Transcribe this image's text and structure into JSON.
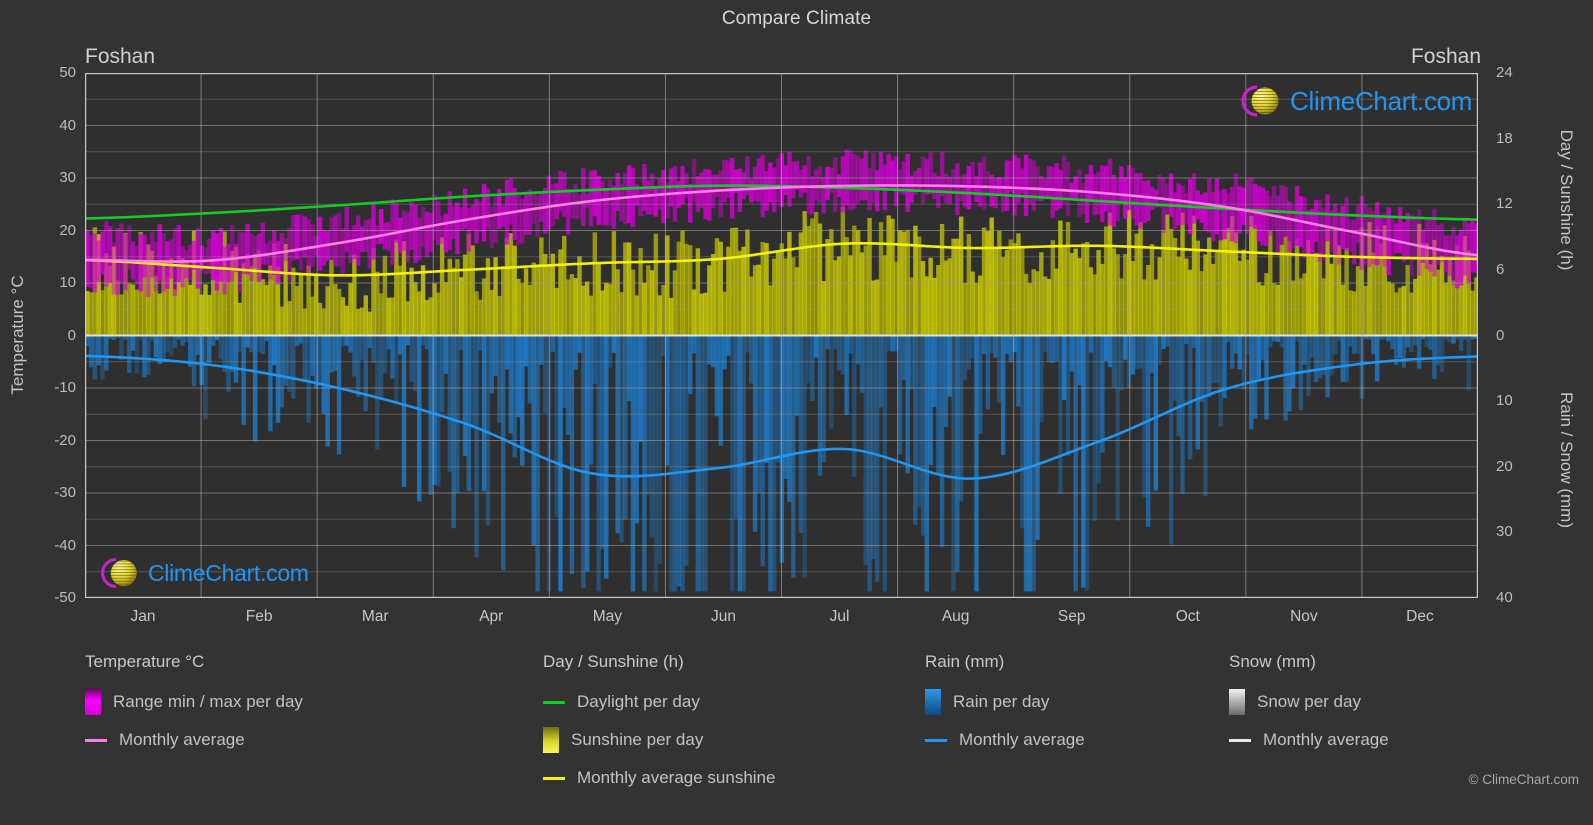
{
  "header": {
    "title": "Compare Climate",
    "city_left": "Foshan",
    "city_right": "Foshan"
  },
  "axes": {
    "left_title": "Temperature °C",
    "right_top_title": "Day / Sunshine (h)",
    "right_bottom_title": "Rain / Snow (mm)",
    "left_ticks": [
      "50",
      "40",
      "30",
      "20",
      "10",
      "0",
      "-10",
      "-20",
      "-30",
      "-40",
      "-50"
    ],
    "right_top_ticks": [
      "24",
      "18",
      "12",
      "6",
      "0"
    ],
    "right_bottom_ticks": [
      "0",
      "10",
      "20",
      "30",
      "40"
    ],
    "x_ticks": [
      "Jan",
      "Feb",
      "Mar",
      "Apr",
      "May",
      "Jun",
      "Jul",
      "Aug",
      "Sep",
      "Oct",
      "Nov",
      "Dec"
    ]
  },
  "watermark": {
    "text": "ClimeChart.com",
    "copyright": "© ClimeChart.com"
  },
  "colors": {
    "background": "#333333",
    "grid": "#9a9a9a",
    "temp_range": "#d900d9",
    "temp_avg": "#ff7fe8",
    "daylight": "#11cc22",
    "sunshine": "#e8e800",
    "sunshine_avg": "#f2f20a",
    "rain": "#1a7fd4",
    "rain_avg": "#2196f3",
    "snow": "#e0e0e0",
    "snow_avg": "#e8e8e8",
    "text": "#c8c8c8"
  },
  "legend": {
    "temperature": {
      "head": "Temperature °C",
      "items": [
        {
          "label": "Range min / max per day",
          "type": "swatch",
          "color": "#d900d9"
        },
        {
          "label": "Monthly average",
          "type": "line",
          "color": "#ff7fe8"
        }
      ]
    },
    "daysunshine": {
      "head": "Day / Sunshine (h)",
      "items": [
        {
          "label": "Daylight per day",
          "type": "line",
          "color": "#11cc22"
        },
        {
          "label": "Sunshine per day",
          "type": "swatch",
          "color": "#e8e800"
        },
        {
          "label": "Monthly average sunshine",
          "type": "line",
          "color": "#f2f20a"
        }
      ]
    },
    "rain": {
      "head": "Rain (mm)",
      "items": [
        {
          "label": "Rain per day",
          "type": "swatch",
          "color": "#1a7fd4"
        },
        {
          "label": "Monthly average",
          "type": "line",
          "color": "#2196f3"
        }
      ]
    },
    "snow": {
      "head": "Snow (mm)",
      "items": [
        {
          "label": "Snow per day",
          "type": "swatch",
          "color": "#e0e0e0"
        },
        {
          "label": "Monthly average",
          "type": "line",
          "color": "#e8e8e8"
        }
      ]
    }
  },
  "chart_data": {
    "type": "line",
    "title": "Compare Climate",
    "location": "Foshan",
    "xlabel": "",
    "ylabel": "Temperature °C",
    "categories": [
      "Jan",
      "Feb",
      "Mar",
      "Apr",
      "May",
      "Jun",
      "Jul",
      "Aug",
      "Sep",
      "Oct",
      "Nov",
      "Dec"
    ],
    "axis_left": {
      "label": "Temperature °C",
      "unit": "°C",
      "min": -50,
      "max": 50,
      "step": 10
    },
    "axis_right_top": {
      "label": "Day / Sunshine (h)",
      "unit": "h",
      "min": 0,
      "max": 24,
      "step": 6
    },
    "axis_right_bottom": {
      "label": "Rain / Snow (mm)",
      "unit": "mm",
      "min": 0,
      "max": 40,
      "step": 10
    },
    "grid": true,
    "legend_position": "bottom",
    "series": [
      {
        "name": "Monthly average",
        "group": "Temperature °C",
        "unit": "°C",
        "color": "#ff7fe8",
        "axis": "left",
        "values": [
          14.4,
          14.3,
          17.6,
          22.0,
          25.6,
          27.6,
          28.5,
          28.4,
          27.2,
          24.5,
          19.8,
          15.3
        ]
      },
      {
        "name": "Range min / max per day",
        "group": "Temperature °C",
        "unit": "°C",
        "color": "#d900d9",
        "axis": "left",
        "min_values": [
          10.0,
          10.2,
          13.5,
          18.0,
          22.0,
          24.5,
          25.5,
          25.4,
          23.6,
          20.2,
          15.3,
          11.0
        ],
        "max_values": [
          19.5,
          19.0,
          22.0,
          26.2,
          29.5,
          31.5,
          32.8,
          32.6,
          31.3,
          28.6,
          24.6,
          20.5
        ]
      },
      {
        "name": "Daylight per day",
        "group": "Day / Sunshine (h)",
        "unit": "h",
        "color": "#11cc22",
        "axis": "right_top",
        "values": [
          10.7,
          11.2,
          11.9,
          12.7,
          13.3,
          13.7,
          13.5,
          13.0,
          12.3,
          11.6,
          11.0,
          10.6
        ]
      },
      {
        "name": "Monthly average sunshine",
        "group": "Day / Sunshine (h)",
        "unit": "h",
        "color": "#f2f20a",
        "axis": "right_top",
        "values": [
          6.9,
          6.2,
          5.5,
          6.0,
          6.6,
          7.0,
          8.4,
          8.0,
          8.2,
          7.7,
          7.2,
          7.0
        ]
      },
      {
        "name": "Monthly average rain",
        "group": "Rain (mm)",
        "unit": "mm",
        "color": "#2196f3",
        "axis": "right_bottom",
        "values": [
          3.1,
          4.5,
          8.0,
          13.4,
          21.0,
          20.2,
          17.3,
          21.8,
          16.2,
          8.2,
          4.5,
          3.2
        ]
      }
    ]
  }
}
